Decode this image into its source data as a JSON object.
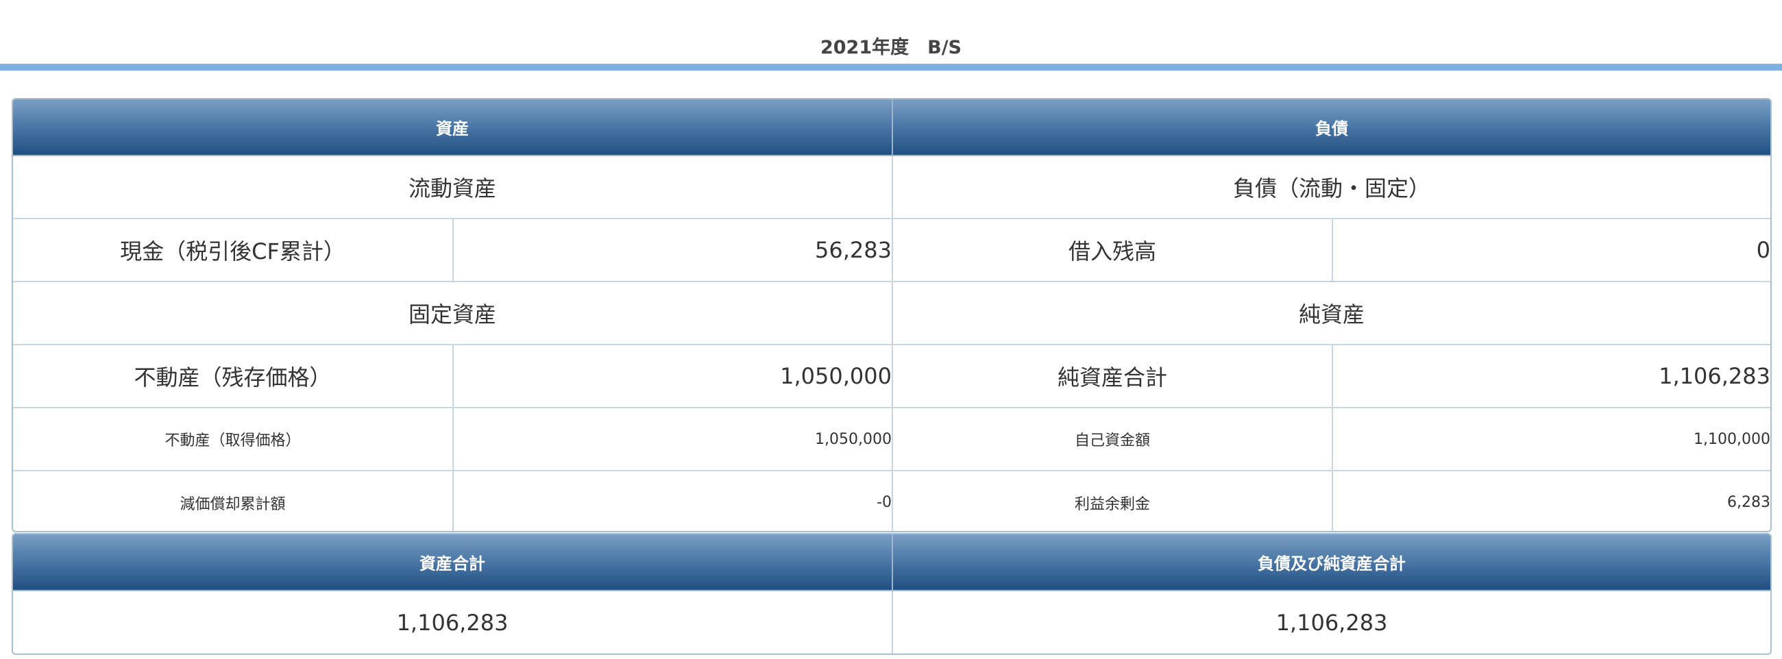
{
  "page": {
    "title": "2021年度　B/S"
  },
  "balance_sheet": {
    "assets_header": "資産",
    "liabilities_header": "負債",
    "current_assets_label": "流動資産",
    "liabilities_section_label": "負債（流動・固定）",
    "cash_label": "現金（税引後CF累計）",
    "cash_value": "56,283",
    "loan_label": "借入残高",
    "loan_value": "0",
    "fixed_assets_label": "固定資産",
    "net_assets_section_label": "純資産",
    "real_estate_residual_label": "不動産（残存価格）",
    "real_estate_residual_value": "1,050,000",
    "net_assets_total_label": "純資産合計",
    "net_assets_total_value": "1,106,283",
    "real_estate_acquisition_label": "不動産（取得価格）",
    "real_estate_acquisition_value": "1,050,000",
    "own_funds_label": "自己資金額",
    "own_funds_value": "1,100,000",
    "depreciation_label": "減価償却累計額",
    "depreciation_value": "-0",
    "retained_earnings_label": "利益余剰金",
    "retained_earnings_value": "6,283"
  },
  "totals": {
    "assets_total_header": "資産合計",
    "liabilities_equity_total_header": "負債及び純資産合計",
    "assets_total_value": "1,106,283",
    "liabilities_equity_total_value": "1,106,283"
  }
}
